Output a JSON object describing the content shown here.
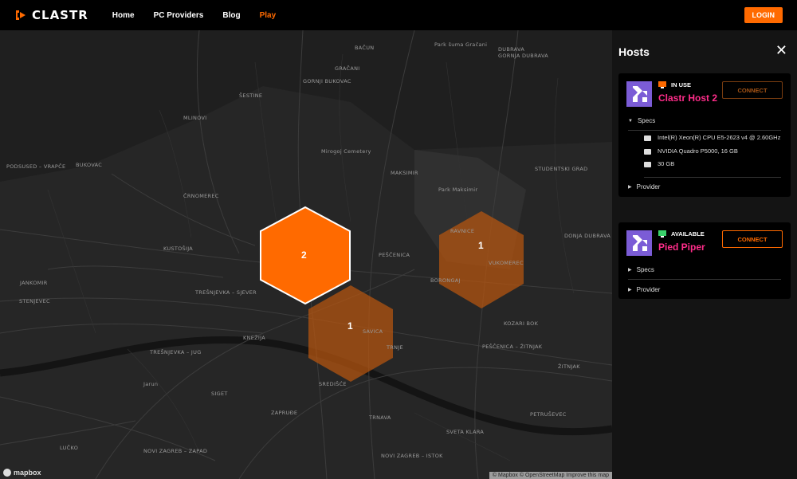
{
  "brand": {
    "name": "CLASTR"
  },
  "nav": {
    "links": [
      "Home",
      "PC Providers",
      "Blog",
      "Play"
    ],
    "active": "Play",
    "login": "LOGIN"
  },
  "map": {
    "clusters": [
      {
        "count": "2",
        "highlighted": true
      },
      {
        "count": "1",
        "highlighted": false
      },
      {
        "count": "1",
        "highlighted": false
      }
    ],
    "labels": [
      "BAČUN",
      "Park šuma Gračani",
      "GRAČANI",
      "ŠESTINE",
      "GORNJI BUKOVAC",
      "DUBRAVA",
      "GORNJA DUBRAVA",
      "MLINOVI",
      "BUKOVAC",
      "PODSUSED – VRAPČE",
      "STENJEVEC",
      "ČRNOMEREC",
      "TREŠNJEVKA – SJEVER",
      "TREŠNJEVKA – JUG",
      "MAKSIMIR",
      "PEŠČENICA",
      "PEŠČENICA – ŽITNJAK",
      "NOVI ZAGREB – ZAPAD",
      "NOVI ZAGREB – ISTOK",
      "LUČKO",
      "JANKOMIR",
      "KUSTOŠIJA",
      "RAVNICE",
      "VUKOMEREC",
      "KOZARI BOK",
      "BORONGAJ",
      "ŽITNJAK",
      "TRNAVA",
      "SVETA KLARA",
      "STUDENTSKI GRAD",
      "DONJA DUBRAVA",
      "Park Maksimir",
      "Mirogoj Cemetery",
      "Jarun",
      "SAVICA",
      "TRNJE",
      "KNEŽIJA",
      "SREDIŠĆE",
      "PETRUŠEVEC",
      "SIGET",
      "ZAPRUĐE"
    ],
    "mapbox": "mapbox",
    "attribution": "© Mapbox © OpenStreetMap Improve this map"
  },
  "panel": {
    "title": "Hosts",
    "hosts": [
      {
        "status": "IN USE",
        "name": "Clastr Host 2",
        "connect": "CONNECT",
        "specs_label": "Specs",
        "provider_label": "Provider",
        "specs": [
          "Intel(R) Xeon(R) CPU E5-2623 v4 @ 2.60GHz",
          "NVIDIA Quadro P5000, 16 GB",
          "30 GB"
        ]
      },
      {
        "status": "AVAILABLE",
        "name": "Pied Piper",
        "connect": "CONNECT",
        "specs_label": "Specs",
        "provider_label": "Provider"
      }
    ]
  },
  "colors": {
    "accent": "#ff6a00",
    "host_name": "#ff2d8a",
    "avatar": "#7b5cd6"
  }
}
